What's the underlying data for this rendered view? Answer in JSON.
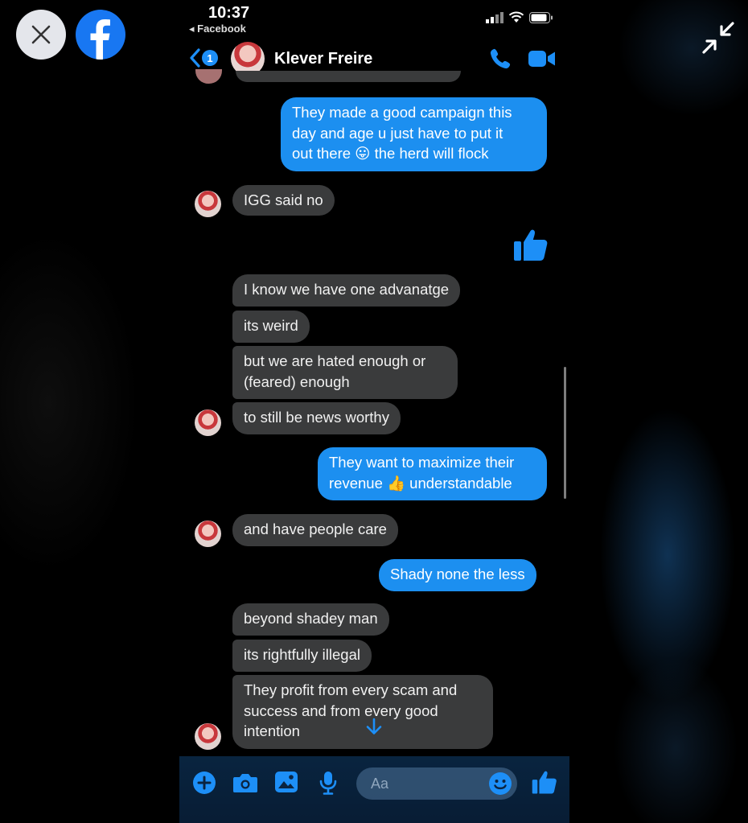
{
  "viewer": {
    "close_icon": "close-icon",
    "app_logo": "facebook-logo",
    "expand_icon": "collapse-arrows-icon"
  },
  "statusbar": {
    "time": "10:37",
    "back_app": "◂ Facebook"
  },
  "header": {
    "back_badge": "1",
    "contact_name": "Klever Freire"
  },
  "messages": [
    {
      "from": "me",
      "text": "They made a good campaign this\nday and age u just have to put it\nout there 😛 the herd will flock"
    },
    {
      "from": "them",
      "text": "IGG said no"
    },
    {
      "from": "me",
      "type": "like"
    },
    {
      "from": "them",
      "text": "I know we have one advanatge"
    },
    {
      "from": "them",
      "text": "its weird"
    },
    {
      "from": "them",
      "text": "but we are hated enough or\n(feared) enough"
    },
    {
      "from": "them",
      "text": "to still be news worthy"
    },
    {
      "from": "me",
      "text": "They want to maximize their\nrevenue 👍 understandable"
    },
    {
      "from": "them",
      "text": "and have people care"
    },
    {
      "from": "me",
      "text": "Shady none the less"
    },
    {
      "from": "them",
      "text": "beyond shadey man"
    },
    {
      "from": "them",
      "text": "its rightfully illegal"
    },
    {
      "from": "them",
      "text": "They profit from every scam and\nsuccess and from every good\nintention"
    }
  ],
  "composer": {
    "placeholder": "Aa"
  },
  "colors": {
    "outgoing": "#1c8ff0",
    "incoming": "#3a3b3c",
    "accent": "#1d8ff7"
  }
}
